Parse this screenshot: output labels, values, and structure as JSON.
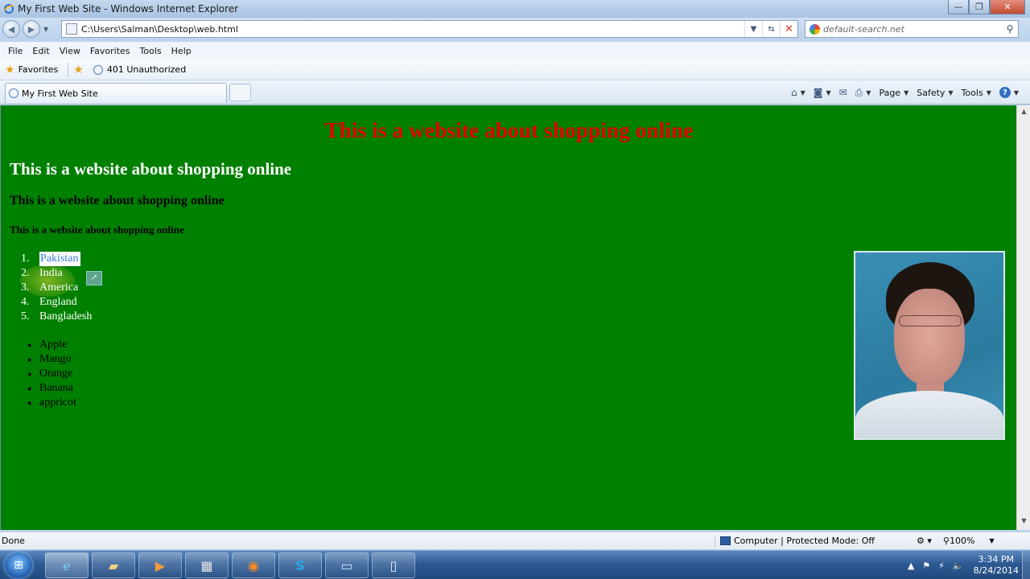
{
  "window": {
    "title": "My First Web Site - Windows Internet Explorer",
    "min_glyph": "—",
    "max_glyph": "❐",
    "close_glyph": "✕"
  },
  "address_bar": {
    "url": "C:\\Users\\Salman\\Desktop\\web.html",
    "search_placeholder": "default-search.net"
  },
  "menu": [
    "File",
    "Edit",
    "View",
    "Favorites",
    "Tools",
    "Help"
  ],
  "favorites_bar": {
    "favorites_label": "Favorites",
    "items": [
      "401 Unauthorized"
    ]
  },
  "tabs": [
    {
      "label": "My First Web Site"
    }
  ],
  "command_bar": {
    "page": "Page",
    "safety": "Safety",
    "tools": "Tools"
  },
  "page": {
    "background": "#008000",
    "h1": "This is a website about shopping online",
    "h2": "This is a website about shopping online",
    "h3": "This is a website about shopping online",
    "h4": "This is a website about shopping online",
    "ordered_list": [
      {
        "num": "1.",
        "text": "Pakistan"
      },
      {
        "num": "2.",
        "text": "India"
      },
      {
        "num": "3.",
        "text": "America"
      },
      {
        "num": "4.",
        "text": "England"
      },
      {
        "num": "5.",
        "text": "Bangladesh"
      }
    ],
    "unordered_list": [
      "Apple",
      "Mango",
      "Orange",
      "Banana",
      "appricot"
    ]
  },
  "status_bar": {
    "status": "Done",
    "zone": "Computer | Protected Mode: Off",
    "zoom": "100%"
  },
  "taskbar": {
    "time": "3:34 PM",
    "date": "8/24/2014"
  },
  "colors": {
    "heading_red": "#e20000",
    "selection_text": "#3a7bd5"
  }
}
